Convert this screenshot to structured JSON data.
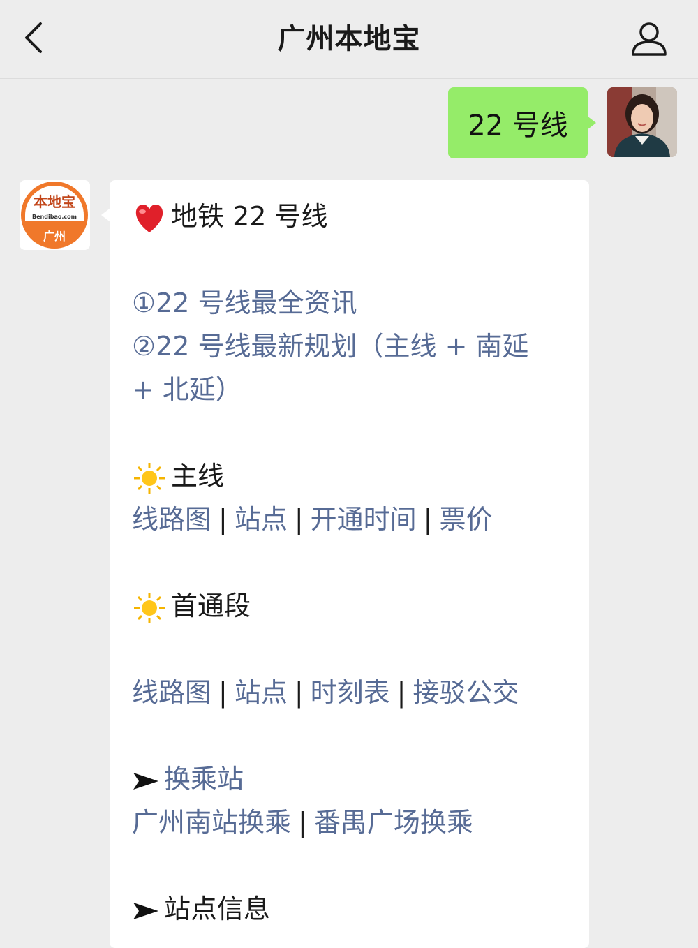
{
  "header": {
    "title": "广州本地宝",
    "back_icon": "chevron-left-icon",
    "profile_icon": "person-icon"
  },
  "outgoing": {
    "text": "22 号线",
    "bubble_color": "#95ec69"
  },
  "bot": {
    "logo_main": "本地宝",
    "logo_sub": "Bendibao.com",
    "logo_city": "广州",
    "logo_color": "#f0782a"
  },
  "reply": {
    "heading": "地铁 22 号线",
    "heading_icon": "heart-icon",
    "link1": "①22 号线最全资讯",
    "link2_a": "②22 号线最新规划（主线 + 南延",
    "link2_b": "+ 北延）",
    "section_main": "主线",
    "main_links": [
      "线路图",
      "站点",
      "开通时间",
      "票价"
    ],
    "section_first": "首通段",
    "first_links": [
      "线路图",
      "站点",
      "时刻表",
      "接驳公交"
    ],
    "section_transfer": "换乘站",
    "transfer_links": [
      "广州南站换乘",
      "番禺广场换乘"
    ],
    "section_stations": "站点信息",
    "separator": "|",
    "link_color": "#576b95"
  }
}
